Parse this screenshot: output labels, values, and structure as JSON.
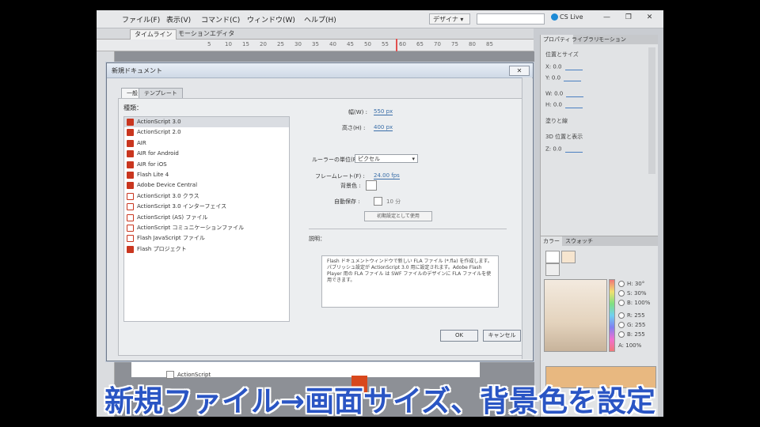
{
  "menubar": {
    "items": [
      "ファイル(F)",
      "表示(V)",
      "コマンド(C)",
      "ウィンドウ(W)",
      "ヘルプ(H)"
    ],
    "workspace": "デザイナ ▾",
    "search_placeholder": "",
    "cs_live": "CS Live",
    "window_controls": "— ❐ ✕"
  },
  "timeline": {
    "tabs": [
      "タイムライン",
      "モーションエディタ"
    ],
    "frame_numbers": [
      "5",
      "10",
      "15",
      "20",
      "25",
      "30",
      "35",
      "40",
      "45",
      "50",
      "55",
      "60",
      "65",
      "70",
      "75",
      "80",
      "85"
    ]
  },
  "dialog": {
    "title": "新規ドキュメント",
    "tabs": [
      "一般",
      "テンプレート"
    ],
    "type_label": "種類：",
    "types": [
      "ActionScript 3.0",
      "ActionScript 2.0",
      "AIR",
      "AIR for Android",
      "AIR for iOS",
      "Flash Lite 4",
      "Adobe Device Central",
      "ActionScript 3.0 クラス",
      "ActionScript 3.0 インターフェイス",
      "ActionScript (AS) ファイル",
      "ActionScript コミュニケーションファイル",
      "Flash JavaScript ファイル",
      "Flash プロジェクト"
    ],
    "selected_index": 0,
    "fields": {
      "width_label": "幅(W) :",
      "width_value": "550 px",
      "height_label": "高さ(H) :",
      "height_value": "400 px",
      "ruler_label": "ルーラーの単位(R) :",
      "ruler_value": "ピクセル",
      "fps_label": "フレームレート(F) :",
      "fps_value": "24.00 fps",
      "bg_label": "背景色 :",
      "auto_save_label": "自動保存 :",
      "auto_save_value": "10 分",
      "make_default": "初期設定として使用"
    },
    "desc_label": "説明：",
    "description": "Flash ドキュメントウィンドウで新しい FLA ファイル (*.fla) を作成します。パブリッシュ設定が ActionScript 3.0 用に設定されます。Adobe Flash Player 用の FLA ファイル は SWF ファイルのデザインに FLA ファイルを使用できます。",
    "ok_label": "OK",
    "cancel_label": "キャンセル"
  },
  "properties": {
    "tabs": [
      "プロパティ",
      "ライブラリ",
      "モーション"
    ],
    "rows": [
      "位置とサイズ",
      "X: 0.0",
      "Y: 0.0",
      "W: 0.0",
      "H: 0.0",
      "塗りと線",
      "3D 位置と表示",
      "Z: 0.0"
    ]
  },
  "color_panel": {
    "tabs": [
      "カラー",
      "スウォッチ"
    ],
    "radio_items": [
      "H: 30°",
      "S: 30%",
      "B: 100%",
      "R: 255",
      "G: 255",
      "B: 255"
    ],
    "alpha": "A: 100%",
    "accent": "#e8b880"
  },
  "stage": {
    "mini_item": "ActionScript"
  },
  "caption": "新規ファイル→画面サイズ、背景色を設定"
}
